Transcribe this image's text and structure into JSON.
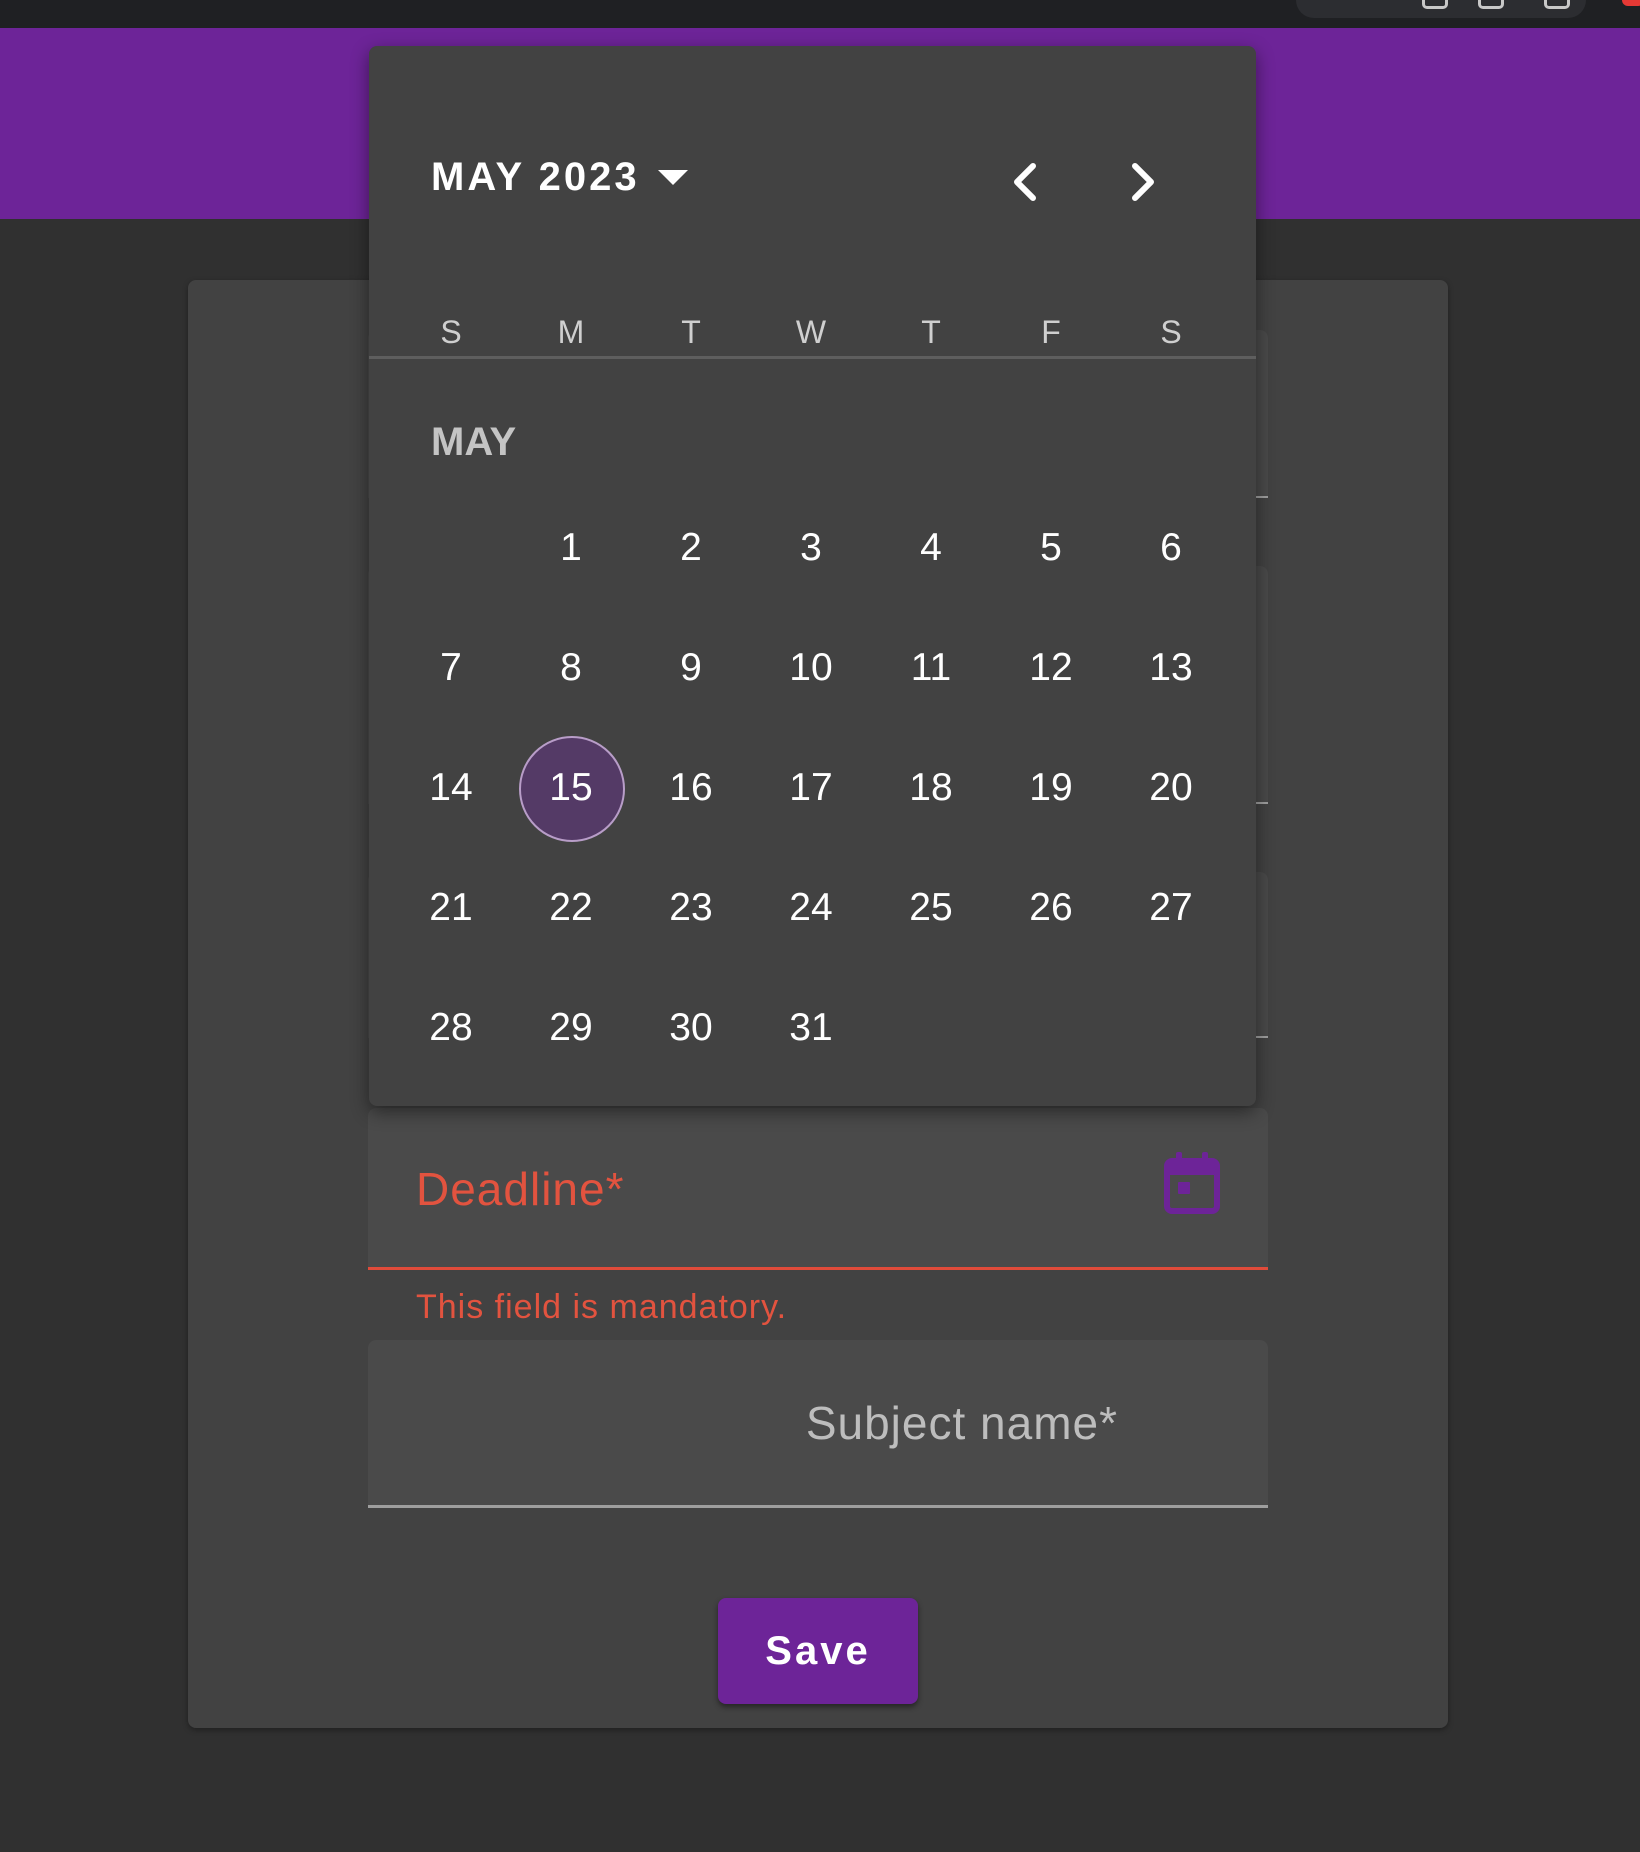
{
  "form": {
    "deadline_label": "Deadline*",
    "deadline_error": "This field is mandatory.",
    "subject_label": "Subject name*",
    "save_label": "Save"
  },
  "calendar": {
    "period_label": "MAY 2023",
    "month_label": "MAY",
    "weekdays": [
      "S",
      "M",
      "T",
      "W",
      "T",
      "F",
      "S"
    ],
    "weeks": [
      [
        "",
        "1",
        "2",
        "3",
        "4",
        "5",
        "6"
      ],
      [
        "7",
        "8",
        "9",
        "10",
        "11",
        "12",
        "13"
      ],
      [
        "14",
        "15",
        "16",
        "17",
        "18",
        "19",
        "20"
      ],
      [
        "21",
        "22",
        "23",
        "24",
        "25",
        "26",
        "27"
      ],
      [
        "28",
        "29",
        "30",
        "31",
        "",
        "",
        ""
      ]
    ],
    "selected_day": "15"
  },
  "colors": {
    "accent": "#6d2498",
    "error": "#e2533f",
    "selected_day": "#543a66"
  },
  "icons": {
    "calendar_toggle": "calendar-icon",
    "previous_month": "chevron-left-icon",
    "next_month": "chevron-right-icon",
    "period_dropdown": "caret-down-icon"
  }
}
